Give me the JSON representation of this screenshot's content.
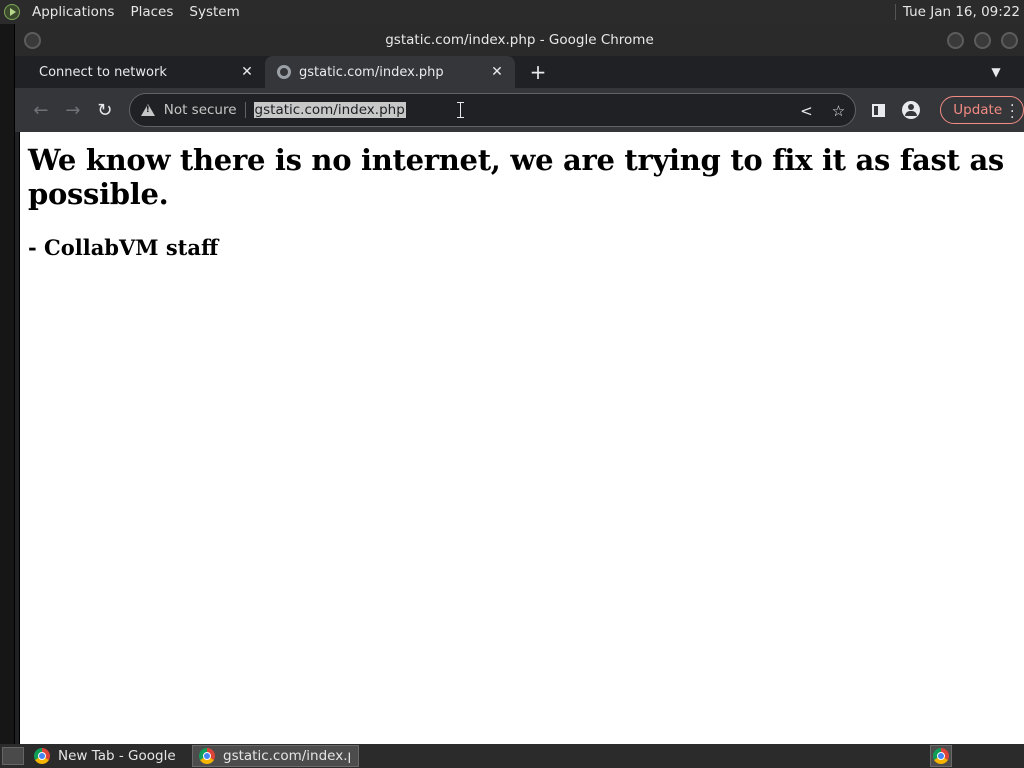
{
  "top_panel": {
    "menus": [
      "Applications",
      "Places",
      "System"
    ],
    "clock": "Tue Jan 16, 09:22"
  },
  "window": {
    "title": "gstatic.com/index.php - Google Chrome"
  },
  "tabs": [
    {
      "title": "Connect to network",
      "active": false
    },
    {
      "title": "gstatic.com/index.php",
      "active": true
    }
  ],
  "toolbar": {
    "security_label": "Not secure",
    "url": "gstatic.com/index.php",
    "update_label": "Update"
  },
  "page": {
    "heading": "We know there is no internet, we are trying to fix it as fast as possible.",
    "signature": "- CollabVM staff"
  },
  "taskbar": {
    "tasks": [
      {
        "label": "New Tab - Google ...",
        "active": false
      },
      {
        "label": "gstatic.com/index.p...",
        "active": true
      }
    ]
  },
  "colors": {
    "update_accent": "#f28b82",
    "toolbar_bg": "#35363a",
    "tabstrip_bg": "#202124"
  }
}
